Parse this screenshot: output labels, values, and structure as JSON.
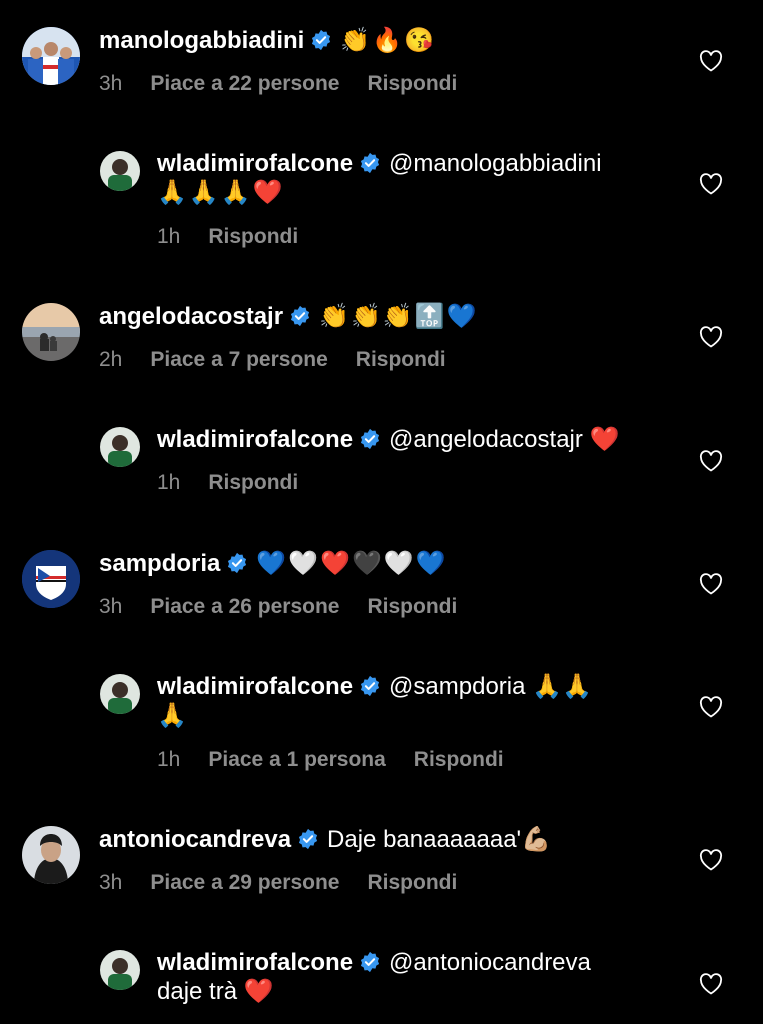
{
  "comments": [
    {
      "username": "manologabbiadini",
      "text": "👏🔥😘",
      "time": "3h",
      "likes": "Piace a 22 persone",
      "reply": "Rispondi"
    },
    {
      "username": "wladimirofalcone",
      "mention": "@manologabbiadini",
      "text2": "🙏🙏🙏❤️",
      "time": "1h",
      "reply": "Rispondi"
    },
    {
      "username": "angelodacostajr",
      "text": "👏👏👏🔝💙",
      "time": "2h",
      "likes": "Piace a 7 persone",
      "reply": "Rispondi"
    },
    {
      "username": "wladimirofalcone",
      "text": "@angelodacostajr ❤️",
      "time": "1h",
      "reply": "Rispondi"
    },
    {
      "username": "sampdoria",
      "text": "💙🤍❤️🖤🤍💙",
      "time": "3h",
      "likes": "Piace a 26 persone",
      "reply": "Rispondi"
    },
    {
      "username": "wladimirofalcone",
      "mention": "@sampdoria 🙏🙏",
      "text2": "🙏",
      "time": "1h",
      "likes": "Piace a 1 persona",
      "reply": "Rispondi"
    },
    {
      "username": "antoniocandreva",
      "text": "Daje banaaaaaaa'💪🏼",
      "time": "3h",
      "likes": "Piace a 29 persone",
      "reply": "Rispondi"
    },
    {
      "username": "wladimirofalcone",
      "mention": "@antoniocandreva",
      "text2": "daje trà ❤️"
    }
  ],
  "icons": {
    "verified": "verified-badge-icon",
    "heart": "heart-outline-icon"
  },
  "colors": {
    "background": "#000000",
    "secondary_text": "#8e8e8e",
    "verified_blue": "#3897f0"
  }
}
